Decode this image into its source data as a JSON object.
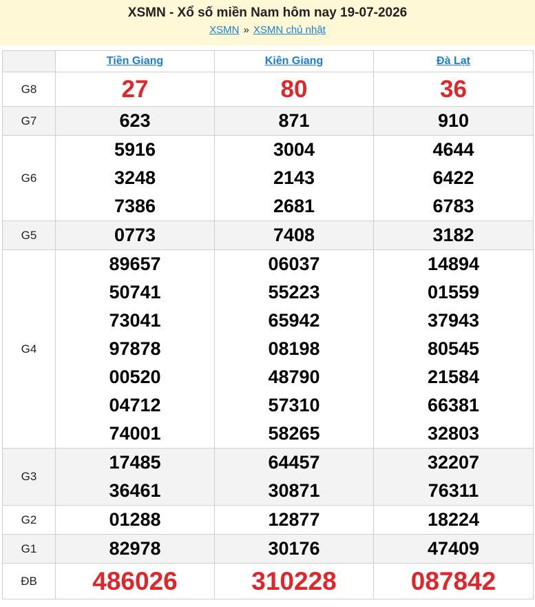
{
  "header": {
    "title": "XSMN - Xổ số miền Nam hôm nay 19-07-2026",
    "breadcrumb": {
      "link1": "XSMN",
      "separator": "»",
      "link2": "XSMN chủ nhật"
    }
  },
  "provinces": [
    "Tiền Giang",
    "Kiên Giang",
    "Đà Lạt"
  ],
  "prizes": {
    "G8": {
      "label": "G8",
      "values": [
        [
          "27"
        ],
        [
          "80"
        ],
        [
          "36"
        ]
      ]
    },
    "G7": {
      "label": "G7",
      "values": [
        [
          "623"
        ],
        [
          "871"
        ],
        [
          "910"
        ]
      ]
    },
    "G6": {
      "label": "G6",
      "values": [
        [
          "5916",
          "3248",
          "7386"
        ],
        [
          "3004",
          "2143",
          "2681"
        ],
        [
          "4644",
          "6422",
          "6783"
        ]
      ]
    },
    "G5": {
      "label": "G5",
      "values": [
        [
          "0773"
        ],
        [
          "7408"
        ],
        [
          "3182"
        ]
      ]
    },
    "G4": {
      "label": "G4",
      "values": [
        [
          "89657",
          "50741",
          "73041",
          "97878",
          "00520",
          "04712",
          "74001"
        ],
        [
          "06037",
          "55223",
          "65942",
          "08198",
          "48790",
          "57310",
          "58265"
        ],
        [
          "14894",
          "01559",
          "37943",
          "80545",
          "21584",
          "66381",
          "32803"
        ]
      ]
    },
    "G3": {
      "label": "G3",
      "values": [
        [
          "17485",
          "36461"
        ],
        [
          "64457",
          "30871"
        ],
        [
          "32207",
          "76311"
        ]
      ]
    },
    "G2": {
      "label": "G2",
      "values": [
        [
          "01288"
        ],
        [
          "12877"
        ],
        [
          "18224"
        ]
      ]
    },
    "G1": {
      "label": "G1",
      "values": [
        [
          "82978"
        ],
        [
          "30176"
        ],
        [
          "47409"
        ]
      ]
    },
    "DB": {
      "label": "ĐB",
      "values": [
        [
          "486026"
        ],
        [
          "310228"
        ],
        [
          "087842"
        ]
      ]
    }
  },
  "colors": {
    "header_bg": "#fff8d6",
    "link": "#1a7fd4",
    "highlight": "#e0262b",
    "alt_row": "#f3f3f3"
  }
}
